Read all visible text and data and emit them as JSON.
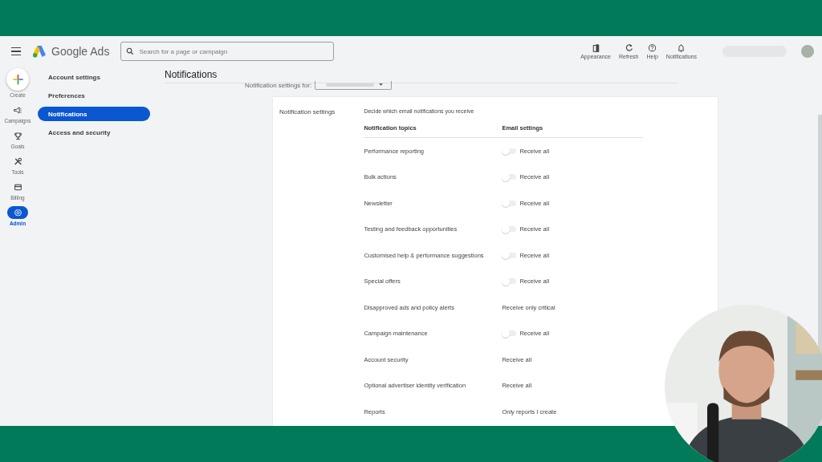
{
  "app": {
    "product": "Google Ads",
    "search": {
      "placeholder": "Search for a page or campaign"
    }
  },
  "toolbar": [
    {
      "kind": "appearance",
      "label": "Appearance"
    },
    {
      "kind": "refresh",
      "label": "Refresh"
    },
    {
      "kind": "help",
      "label": "Help"
    },
    {
      "kind": "bell",
      "label": "Notifications"
    }
  ],
  "rail": [
    {
      "kind": "create",
      "label": "Create",
      "selected": false
    },
    {
      "kind": "megaphone",
      "label": "Campaigns",
      "selected": false
    },
    {
      "kind": "trophy",
      "label": "Goals",
      "selected": false
    },
    {
      "kind": "tools",
      "label": "Tools",
      "selected": false
    },
    {
      "kind": "card",
      "label": "Billing",
      "selected": false
    },
    {
      "kind": "gear",
      "label": "Admin",
      "selected": true
    }
  ],
  "sidebar": {
    "items": [
      {
        "label": "Account settings",
        "selected": false
      },
      {
        "label": "Preferences",
        "selected": false
      },
      {
        "label": "Notifications",
        "selected": true
      },
      {
        "label": "Access and security",
        "selected": false
      }
    ]
  },
  "page": {
    "title": "Notifications",
    "settings_for": "Notification settings for:",
    "card": {
      "heading": "Notification settings",
      "description": "Decide which email notifications you receive",
      "columns": [
        "Notification topics",
        "Email settings"
      ],
      "rows": [
        {
          "topic": "Performance reporting",
          "kind": "toggle",
          "on": false,
          "setting": "Receive all"
        },
        {
          "topic": "Bulk actions",
          "kind": "toggle",
          "on": false,
          "setting": "Receive all"
        },
        {
          "topic": "Newsletter",
          "kind": "toggle",
          "on": false,
          "setting": "Receive all"
        },
        {
          "topic": "Testing and feedback opportunities",
          "kind": "toggle",
          "on": false,
          "setting": "Receive all"
        },
        {
          "topic": "Customised help & performance suggestions",
          "kind": "toggle",
          "on": false,
          "setting": "Receive all"
        },
        {
          "topic": "Special offers",
          "kind": "toggle",
          "on": false,
          "setting": "Receive all"
        },
        {
          "topic": "Disapproved ads and policy alerts",
          "kind": "text",
          "setting": "Receive only critical"
        },
        {
          "topic": "Campaign maintenance",
          "kind": "toggle",
          "on": false,
          "setting": "Receive all"
        },
        {
          "topic": "Account security",
          "kind": "text",
          "setting": "Receive all"
        },
        {
          "topic": "Optional advertiser identity verification",
          "kind": "text",
          "setting": "Receive all"
        },
        {
          "topic": "Reports",
          "kind": "text",
          "setting": "Only reports I create"
        }
      ]
    }
  }
}
